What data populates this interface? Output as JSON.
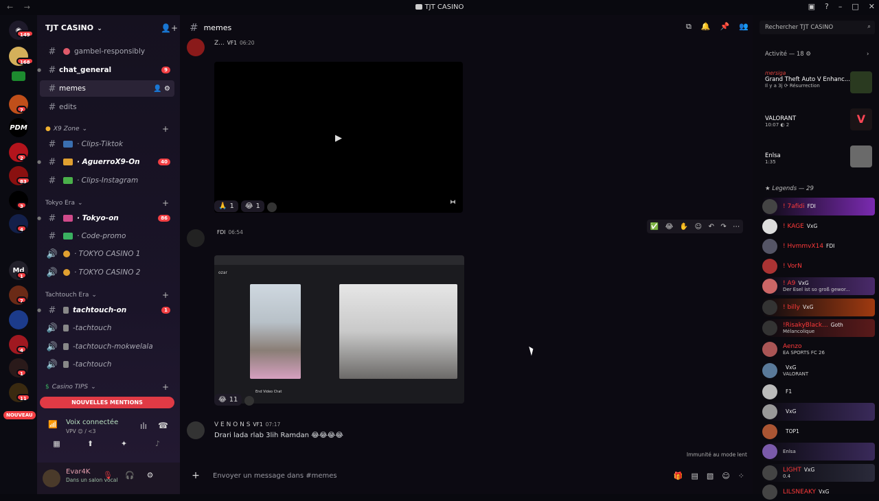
{
  "window": {
    "title": "TJT CASINO"
  },
  "guild_badges": [
    "149",
    "168",
    "7",
    "2",
    "83",
    "3",
    "4",
    "1",
    "7",
    "4",
    "1",
    "11"
  ],
  "guild_labels": [
    "PDM",
    "Md"
  ],
  "guild_new": "NOUVEAU",
  "server": {
    "name": "TJT CASINO"
  },
  "channels": [
    {
      "name": "gambel-responsibly",
      "style": "normal",
      "badge": ""
    },
    {
      "name": "chat_general",
      "style": "bold",
      "badge": "9"
    },
    {
      "name": "memes",
      "style": "active",
      "badge": ""
    },
    {
      "name": "edits",
      "style": "normal",
      "badge": ""
    }
  ],
  "cat_x9": {
    "name": "X9 Zone"
  },
  "x9_channels": [
    {
      "name": "· Clips-Tiktok",
      "badge": ""
    },
    {
      "name": "· AguerroX9-On",
      "badge": "40"
    },
    {
      "name": "· Clips-Instagram",
      "badge": ""
    }
  ],
  "cat_tokyo": {
    "name": "Tokyo Era"
  },
  "tokyo_channels": [
    {
      "name": "· Tokyo-on",
      "badge": "86"
    },
    {
      "name": "· Code-promo",
      "badge": ""
    },
    {
      "name": "· TOKYO CASINO 1",
      "badge": ""
    },
    {
      "name": "· TOKYO CASINO 2",
      "badge": ""
    }
  ],
  "cat_tachtouch": {
    "name": "Tachtouch Era"
  },
  "tachtouch_channels": [
    {
      "name": "tachtouch-on",
      "badge": "1"
    },
    {
      "name": "-tachtouch",
      "badge": ""
    },
    {
      "name": "-tachtouch-mokwelala",
      "badge": ""
    },
    {
      "name": "-tachtouch",
      "badge": ""
    }
  ],
  "cat_tips": {
    "name": "Casino TIPS"
  },
  "mentions_label": "NOUVELLES MENTIONS",
  "voice": {
    "title": "Voix connectée",
    "sub": "VPV 😊 / <3"
  },
  "user": {
    "name": "Evar4K",
    "status": "Dans un salon vocal"
  },
  "header": {
    "channel": "memes",
    "search_placeholder": "Rechercher TJT CASINO"
  },
  "messages": [
    {
      "author": "Z...",
      "tag": "VF1",
      "time": "06:20"
    },
    {
      "author": "",
      "tag": "FDI",
      "time": "06:54"
    },
    {
      "author": "V E N O N S",
      "tag": "VF1",
      "time": "07:17",
      "text": "Drari lada rlab 3lih Ramdan 😂😂😂😂"
    }
  ],
  "reactions1": [
    {
      "emoji": "🙏",
      "count": "1"
    },
    {
      "emoji": "😂",
      "count": "1"
    }
  ],
  "reactions2": [
    {
      "emoji": "😂",
      "count": "11"
    }
  ],
  "screenshot_caption": "End Video Chat",
  "screenshot_brand": "ozar",
  "composer": {
    "placeholder": "Envoyer un message dans #memes"
  },
  "slowmode": "Immunité au mode lent",
  "activity": {
    "header": "Activité — 18",
    "items": [
      {
        "name": "mersiga",
        "game": "Grand Theft Auto V Enhanc...",
        "detail": "Il y a 3j  ⟳ Résurrection"
      },
      {
        "name": "",
        "game": "VALORANT",
        "detail": "10:07  ◐ 2"
      },
      {
        "name": "",
        "game": "Enlsa",
        "detail": "1:35"
      }
    ]
  },
  "legends": {
    "header": "Legends — 29",
    "members": [
      {
        "name": "! 7afidi",
        "tag": "FDI",
        "status": ""
      },
      {
        "name": "! KAGE",
        "tag": "VxG",
        "status": ""
      },
      {
        "name": "! HvmmvX14",
        "tag": "FDI",
        "status": ""
      },
      {
        "name": "! VorN",
        "tag": "",
        "status": ""
      },
      {
        "name": "! A9",
        "tag": "VxG",
        "status": "Der Esel ist so groß gewor..."
      },
      {
        "name": "! billy",
        "tag": "VxG",
        "status": ""
      },
      {
        "name": "!RisakyBlack...",
        "tag": "Goth",
        "status": "Mélancolique"
      },
      {
        "name": "Aenzo",
        "tag": "",
        "status": "EA SPORTS FC 26"
      },
      {
        "name": "",
        "tag": "VxG",
        "status": "VALORANT"
      },
      {
        "name": "",
        "tag": "F1",
        "status": ""
      },
      {
        "name": "",
        "tag": "VxG",
        "status": ""
      },
      {
        "name": "",
        "tag": "TOP1",
        "status": ""
      },
      {
        "name": "",
        "tag": "",
        "status": "Enlsa"
      },
      {
        "name": "LIGHT",
        "tag": "VxG",
        "status": "0.4"
      },
      {
        "name": "LILSNEAKY",
        "tag": "VxG",
        "status": ""
      }
    ]
  }
}
